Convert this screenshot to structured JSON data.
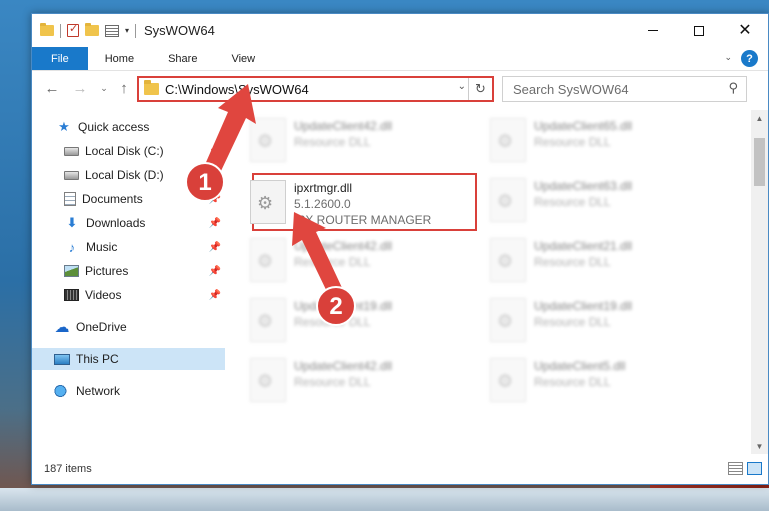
{
  "window": {
    "title": "SysWOW64",
    "controls": {
      "minimize": "",
      "maximize": "",
      "close": "✕"
    }
  },
  "ribbon": {
    "tabs": [
      "File",
      "Home",
      "Share",
      "View"
    ],
    "help": "?"
  },
  "nav": {
    "address": "C:\\Windows\\SysWOW64",
    "search_placeholder": "Search SysWOW64"
  },
  "sidebar": {
    "items": [
      {
        "label": "Quick access",
        "icon": "star-icon"
      },
      {
        "label": "Local Disk (C:)",
        "icon": "disk-icon"
      },
      {
        "label": "Local Disk (D:)",
        "icon": "disk-icon"
      },
      {
        "label": "Documents",
        "icon": "documents-icon"
      },
      {
        "label": "Downloads",
        "icon": "download-icon"
      },
      {
        "label": "Music",
        "icon": "music-icon"
      },
      {
        "label": "Pictures",
        "icon": "pictures-icon"
      },
      {
        "label": "Videos",
        "icon": "videos-icon"
      },
      {
        "label": "OneDrive",
        "icon": "cloud-icon"
      },
      {
        "label": "This PC",
        "icon": "computer-icon"
      },
      {
        "label": "Network",
        "icon": "network-icon"
      }
    ]
  },
  "files": {
    "left": [
      {
        "name": "UpdateClient42.dll",
        "type": "Resource DLL"
      },
      {
        "name": "ipxrtmgr.dll",
        "version": "5.1.2600.0",
        "description": "IPX ROUTER MANAGER"
      },
      {
        "name": "UpdateClient42.dll",
        "type": "Resource DLL"
      },
      {
        "name": "UpdateClient19.dll",
        "type": "Resource DLL"
      },
      {
        "name": "UpdateClient42.dll",
        "type": "Resource DLL"
      }
    ],
    "right": [
      {
        "name": "UpdateClient65.dll",
        "type": "Resource DLL"
      },
      {
        "name": "UpdateClient63.dll",
        "type": "Resource DLL"
      },
      {
        "name": "UpdateClient21.dll",
        "type": "Resource DLL"
      },
      {
        "name": "UpdateClient19.dll",
        "type": "Resource DLL"
      },
      {
        "name": "UpdateClient5.dll",
        "type": "Resource DLL"
      }
    ]
  },
  "status": {
    "count": "187 items"
  },
  "annotations": {
    "step1": "1",
    "step2": "2",
    "arrow_color": "#e0463f"
  }
}
